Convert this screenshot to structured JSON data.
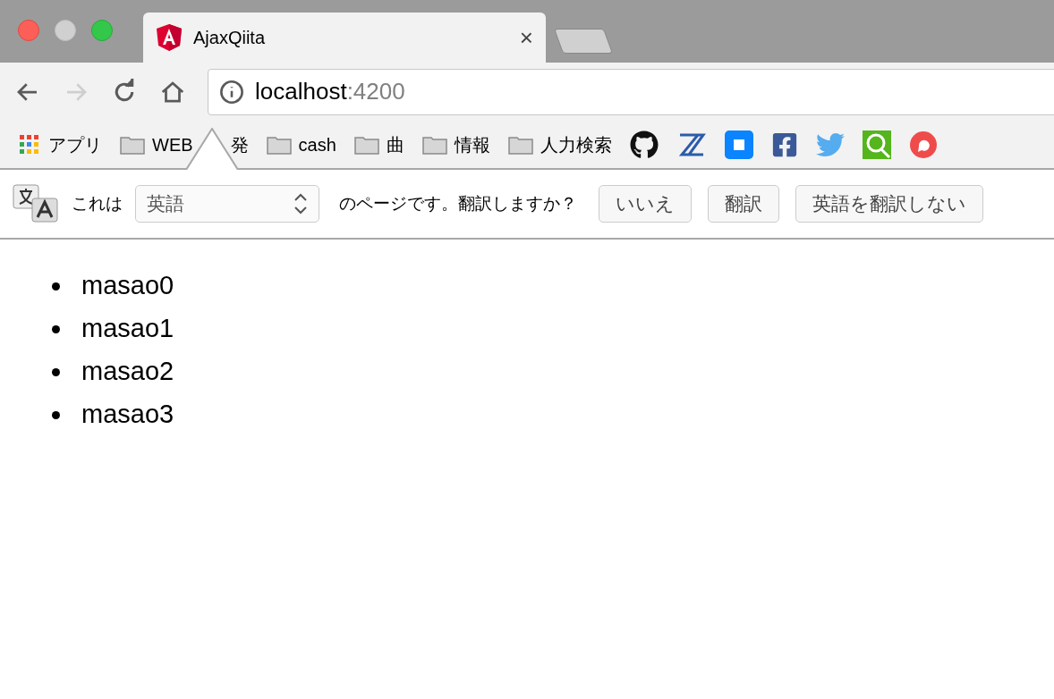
{
  "tab": {
    "title": "AjaxQiita",
    "close": "×"
  },
  "address": {
    "host": "localhost",
    "port": ":4200"
  },
  "bookmarks": [
    {
      "kind": "apps",
      "label": "アプリ"
    },
    {
      "kind": "folder",
      "label": "WEB",
      "label_after_pointer": "発"
    },
    {
      "kind": "folder",
      "label": "cash"
    },
    {
      "kind": "folder",
      "label": "曲"
    },
    {
      "kind": "folder",
      "label": "情報"
    },
    {
      "kind": "folder",
      "label": "人力検索"
    }
  ],
  "translate_bar": {
    "prefix": "これは",
    "language": "英語",
    "suffix": "のページです。翻訳しますか？",
    "buttons": [
      "いいえ",
      "翻訳",
      "英語を翻訳しない"
    ]
  },
  "list": [
    "masao0",
    "masao1",
    "masao2",
    "masao3"
  ]
}
